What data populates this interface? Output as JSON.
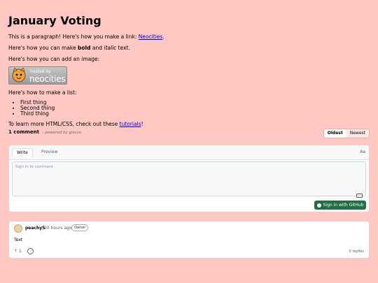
{
  "page": {
    "title": "January Voting",
    "p_link_prefix": "This is a paragraph! Here's how you make a link: ",
    "link_text": "Neocities",
    "p_link_suffix": ".",
    "p_bold_prefix": "Here's how you can make ",
    "bold_word": "bold",
    "p_bold_middle": " and ",
    "italic_word": "italic",
    "p_bold_suffix": " text.",
    "p_image": "Here's how you can add an image:",
    "badge_small": "hosted by",
    "badge_big": "neocities",
    "p_list": "Here's how to make a list:",
    "list_items": [
      "First thing",
      "Second thing",
      "Third thing"
    ],
    "p_learn_prefix": "To learn more HTML/CSS, check out these ",
    "tutorials_link": "tutorials",
    "p_learn_suffix": "!"
  },
  "comments": {
    "count_label": "1 comment",
    "powered_by": "– powered by giscus",
    "sort_oldest": "Oldest",
    "sort_newest": "Newest"
  },
  "editor": {
    "tab_write": "Write",
    "tab_preview": "Preview",
    "format_label": "Aa",
    "placeholder": "Sign in to comment",
    "signin_button": "Sign in with GitHub"
  },
  "comment": {
    "author": "peachy5",
    "time": "20 hours ago",
    "badge": "Owner",
    "body": "Text",
    "upvotes": "↑ 1",
    "replies": "0 replies"
  }
}
